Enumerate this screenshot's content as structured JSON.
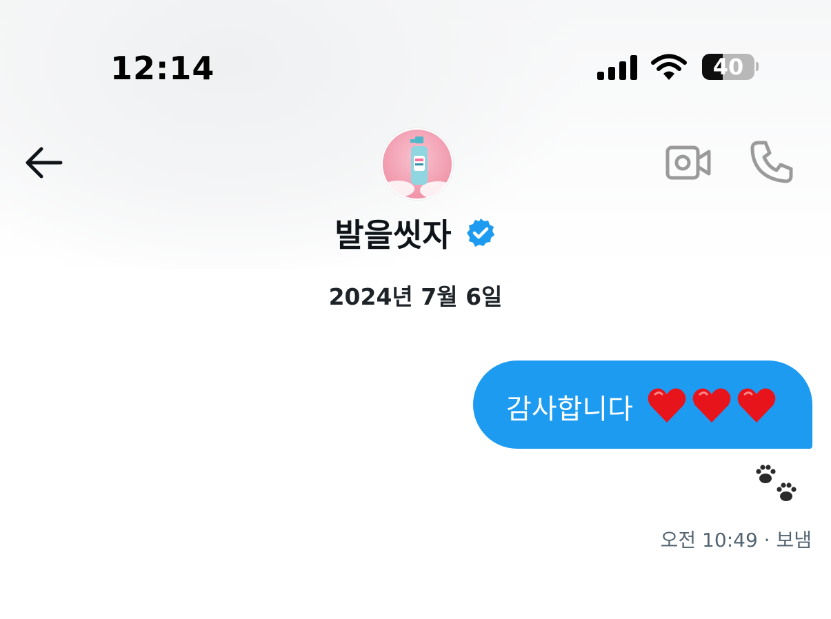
{
  "status_bar": {
    "time": "12:14",
    "battery_level": "40",
    "battery_fraction": 0.4
  },
  "header": {
    "contact_name": "발을씻자",
    "verified": true,
    "icons": [
      "back-arrow-icon",
      "video-camera-icon",
      "phone-icon",
      "verified-badge-icon"
    ]
  },
  "conversation": {
    "date_divider": "2024년 7월 6일",
    "messages": [
      {
        "text": "감사합니다",
        "emoji": "❤️❤️❤️",
        "reaction": "🐾",
        "time": "오전 10:49",
        "status": "· 보냄"
      }
    ]
  },
  "colors": {
    "bubble": "#1d9bf0",
    "verified": "#1d9bf0",
    "meta_text": "#536471",
    "icon_gray": "#9a9a9a"
  }
}
